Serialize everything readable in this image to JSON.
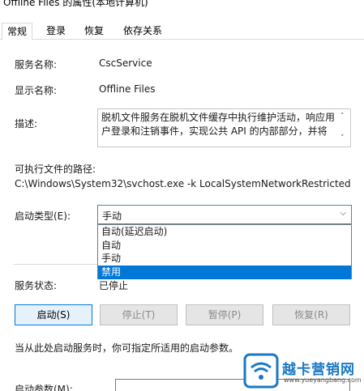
{
  "window": {
    "title": "Offline Files 的属性(本地计算机)"
  },
  "tabs": [
    {
      "label": "常规",
      "active": true
    },
    {
      "label": "登录",
      "active": false
    },
    {
      "label": "恢复",
      "active": false
    },
    {
      "label": "依存关系",
      "active": false
    }
  ],
  "general": {
    "service_name_label": "服务名称:",
    "service_name_value": "CscService",
    "display_name_label": "显示名称:",
    "display_name_value": "Offline Files",
    "description_label": "描述:",
    "description_value": "脱机文件服务在脱机文件缓存中执行维护活动，响应用户登录和注销事件，实现公共 API 的内部部分，并将",
    "exe_path_label": "可执行文件的路径:",
    "exe_path_value": "C:\\Windows\\System32\\svchost.exe -k LocalSystemNetworkRestricted",
    "startup_type_label": "启动类型(E):",
    "startup_type_value": "手动",
    "startup_type_options": [
      "自动(延迟启动)",
      "自动",
      "手动",
      "禁用"
    ],
    "startup_type_highlighted": "禁用",
    "status_label": "服务状态:",
    "status_value": "已停止",
    "note": "当从此处启动服务时，你可指定所适用的启动参数。",
    "params_label": "启动参数(M):"
  },
  "buttons": {
    "start": "启动(S)",
    "stop": "停止(T)",
    "pause": "暂停(P)",
    "resume": "恢复(R)"
  },
  "watermark": {
    "brand": "越卡营销网",
    "url": "www.yueyangbang.com"
  },
  "colors": {
    "accent": "#0078d7",
    "watermark_blue": "#1a78c6"
  }
}
